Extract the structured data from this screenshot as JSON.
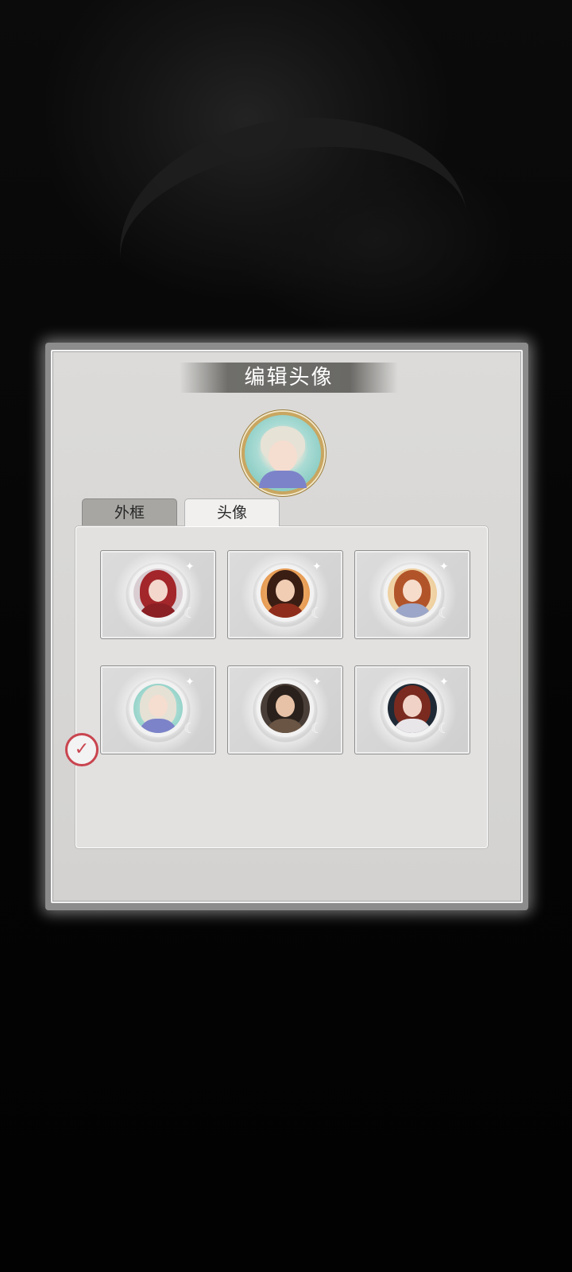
{
  "dialog": {
    "title": "编辑头像",
    "tabs": [
      {
        "label": "外框",
        "selected": false
      },
      {
        "label": "头像",
        "selected": true
      }
    ],
    "current_avatar": {
      "icon": "avatar-silver-hair-girl"
    },
    "avatars": [
      {
        "icon": "avatar-red-hair-lady",
        "selected": false
      },
      {
        "icon": "avatar-dark-hair-gold-crown",
        "selected": false
      },
      {
        "icon": "avatar-auburn-hair-girl",
        "selected": false
      },
      {
        "icon": "avatar-silver-hair-girl",
        "selected": true
      },
      {
        "icon": "avatar-brown-hair-man-hat",
        "selected": false
      },
      {
        "icon": "avatar-red-hair-dark-bg",
        "selected": false
      }
    ],
    "selected_marker": "✓"
  },
  "colors": {
    "accent_selected": "#c9454f",
    "avatar_frame_gold": "#c9a660",
    "banner": "#6f6e6b"
  }
}
